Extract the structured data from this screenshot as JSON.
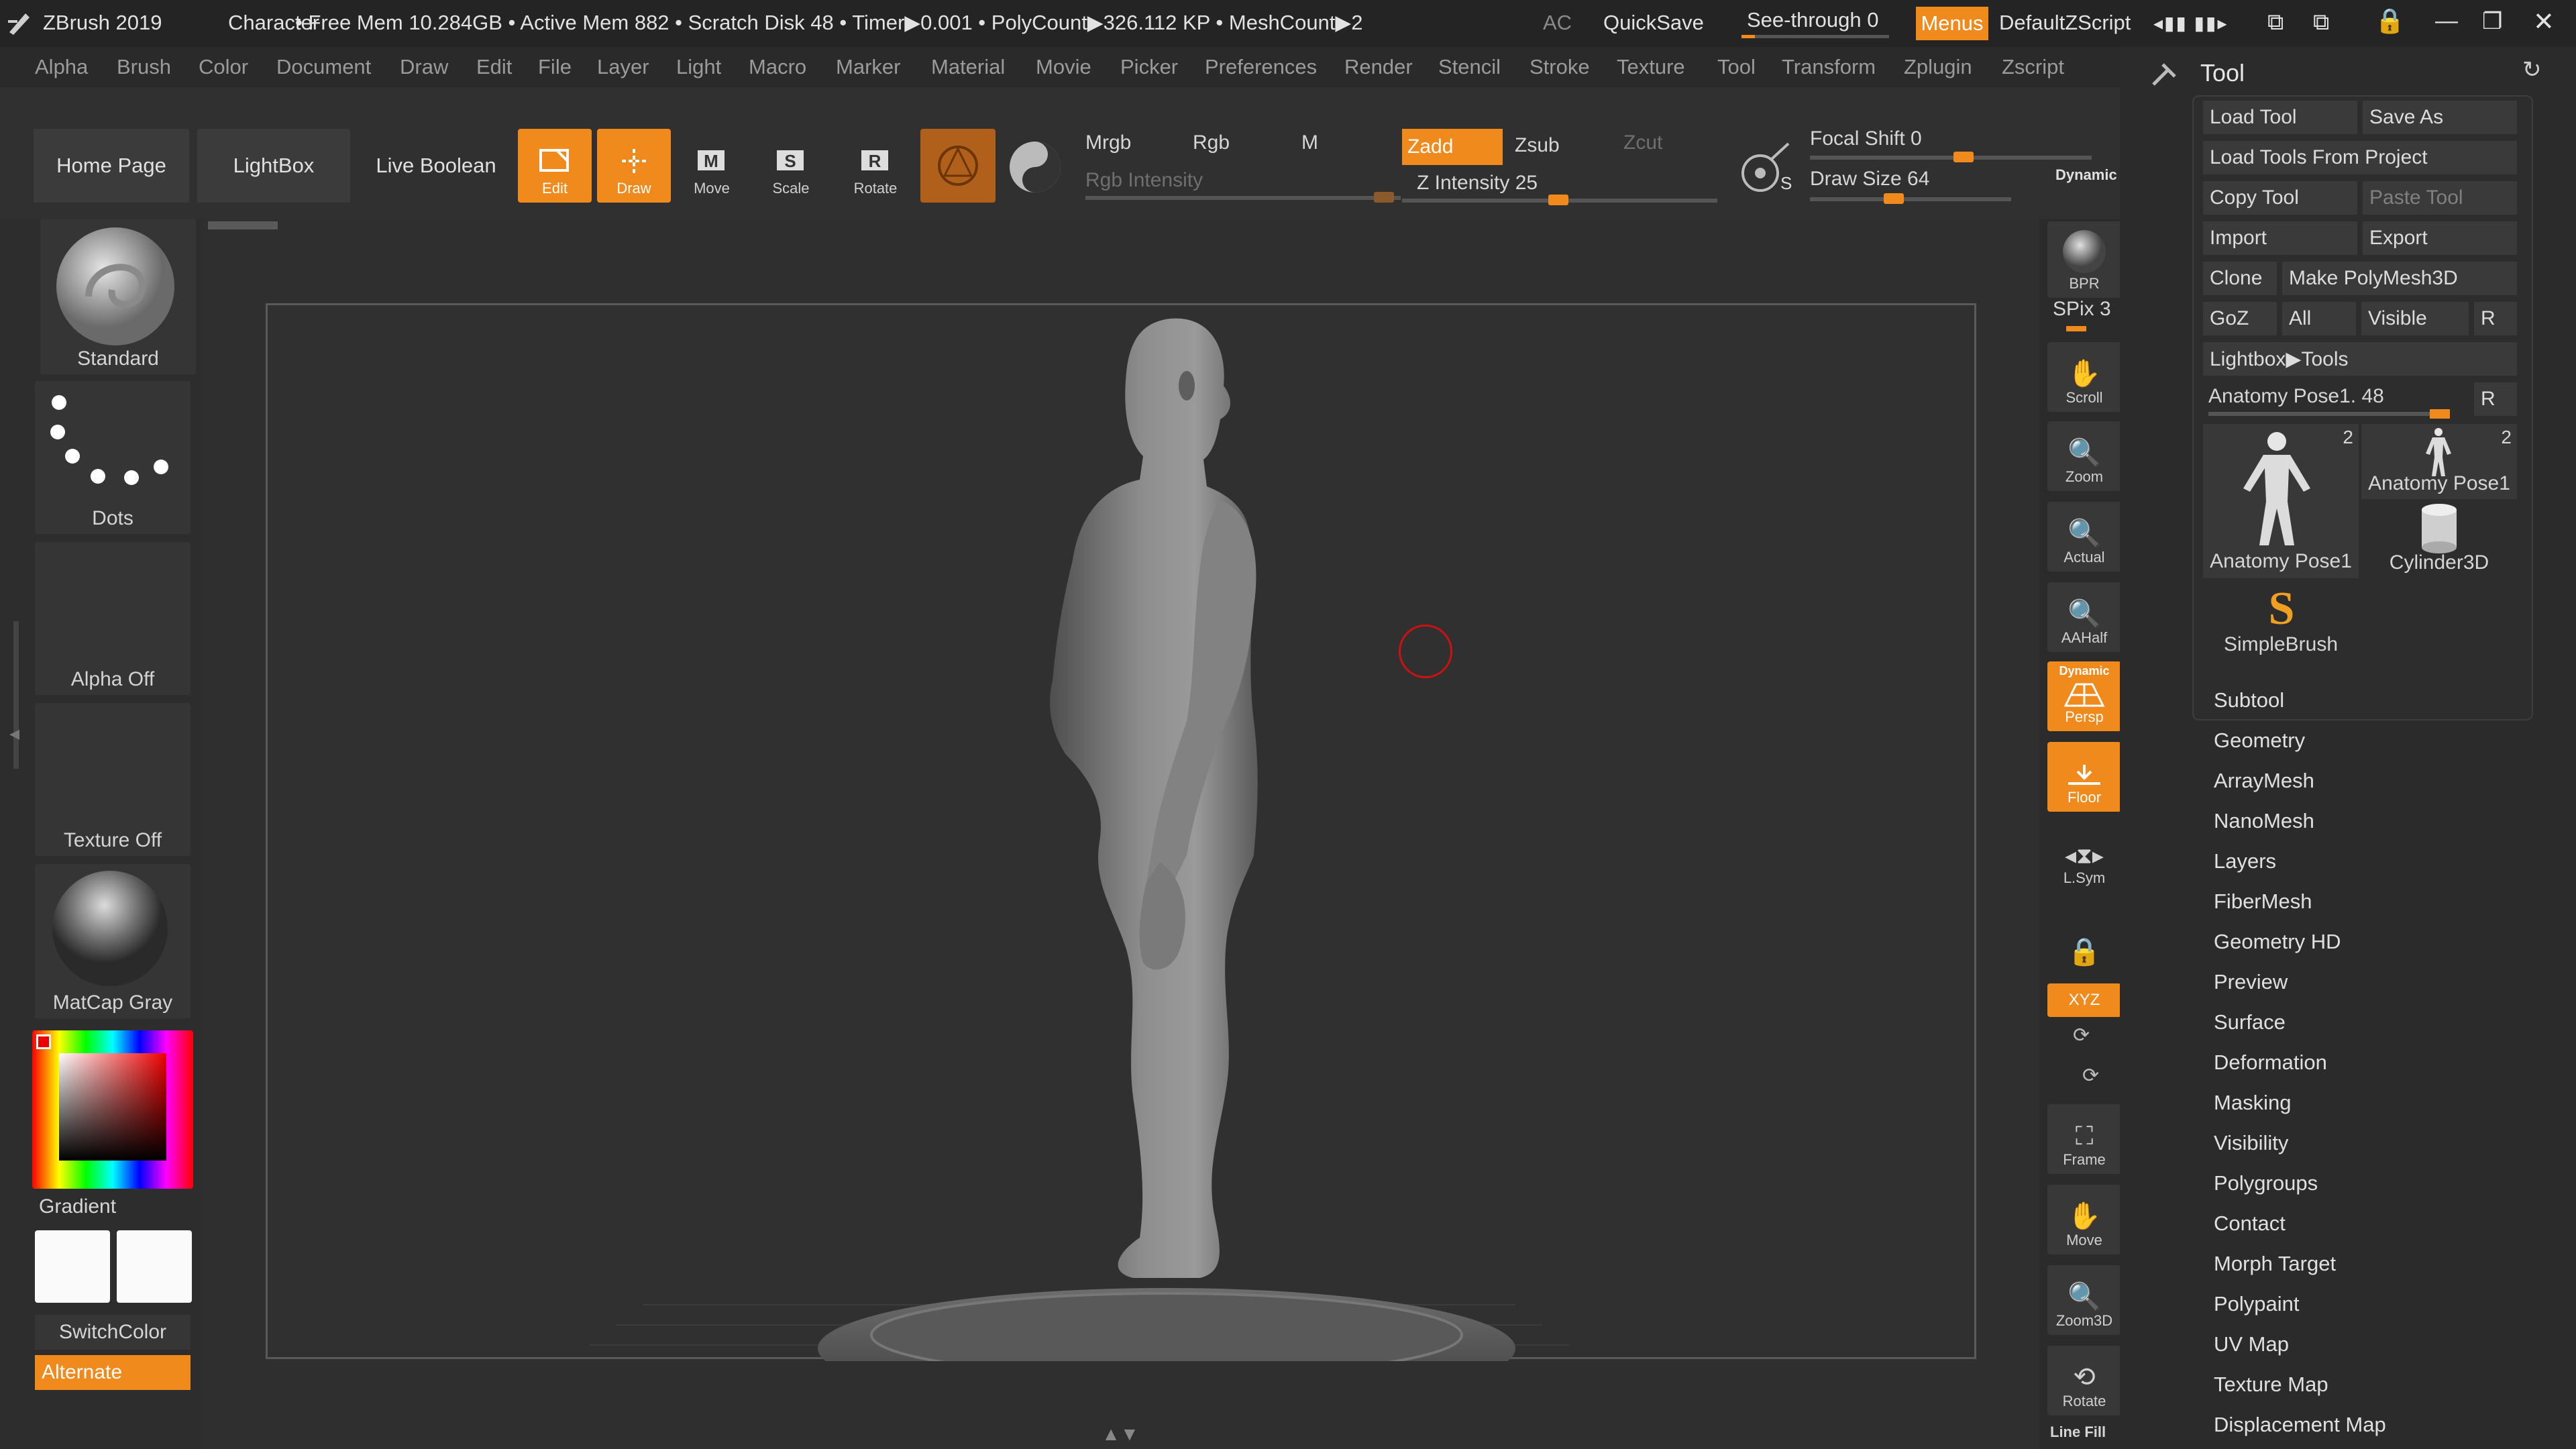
{
  "titlebar": {
    "app": "ZBrush 2019",
    "project": "Character",
    "status": "• Free Mem 10.284GB • Active Mem 882 • Scratch Disk 48 • Timer▶0.001 • PolyCount▶326.112 KP • MeshCount▶2",
    "ac": "AC",
    "quicksave": "QuickSave",
    "seethrough": "See-through  0",
    "seethrough_value": 0,
    "menus": "Menus",
    "script": "DefaultZScript"
  },
  "menubar": [
    "Alpha",
    "Brush",
    "Color",
    "Document",
    "Draw",
    "Edit",
    "File",
    "Layer",
    "Light",
    "Macro",
    "Marker",
    "Material",
    "Movie",
    "Picker",
    "Preferences",
    "Render",
    "Stencil",
    "Stroke",
    "Texture",
    "Tool",
    "Transform",
    "Zplugin",
    "Zscript"
  ],
  "toolbar": {
    "home": "Home Page",
    "lightbox": "LightBox",
    "liveboolean": "Live Boolean",
    "edit": "Edit",
    "draw": "Draw",
    "move": "Move",
    "scale": "Scale",
    "rotate": "Rotate",
    "mrgb": "Mrgb",
    "rgb": "Rgb",
    "m": "M",
    "rgb_intensity": "Rgb Intensity",
    "zadd": "Zadd",
    "zsub": "Zsub",
    "zcut": "Zcut",
    "z_intensity": "Z Intensity 25",
    "z_intensity_value": 25,
    "focal_shift": "Focal Shift 0",
    "focal_shift_value": 0,
    "draw_size": "Draw Size 64",
    "draw_size_value": 64,
    "dynamic": "Dynamic"
  },
  "left_shelf": {
    "brush": "Standard",
    "stroke": "Dots",
    "alpha": "Alpha Off",
    "texture": "Texture Off",
    "material": "MatCap Gray",
    "gradient": "Gradient",
    "switchcolor": "SwitchColor",
    "alternate": "Alternate"
  },
  "right_shelf": {
    "bpr": "BPR",
    "spix": "SPix 3",
    "scroll": "Scroll",
    "zoom": "Zoom",
    "actual": "Actual",
    "aahalf": "AAHalf",
    "persp": "Persp",
    "persp_top": "Dynamic",
    "floor": "Floor",
    "lsym": "L.Sym",
    "xyz": "XYZ",
    "frame": "Frame",
    "move": "Move",
    "zoom3d": "Zoom3D",
    "rotate": "Rotate",
    "linefill": "Line Fill"
  },
  "tool_panel": {
    "title": "Tool",
    "load_tool": "Load Tool",
    "save_as": "Save As",
    "load_from_project": "Load Tools From Project",
    "copy_tool": "Copy Tool",
    "paste_tool": "Paste Tool",
    "import": "Import",
    "export": "Export",
    "clone": "Clone",
    "make_polymesh": "Make PolyMesh3D",
    "goz": "GoZ",
    "all": "All",
    "visible": "Visible",
    "r": "R",
    "lightbox_tools": "Lightbox▶Tools",
    "current_tool": "Anatomy Pose1. 48",
    "current_tool_value": 48,
    "thumbs": [
      {
        "label": "Anatomy Pose1",
        "count": "2"
      },
      {
        "label": "Anatomy Pose1",
        "count": "2"
      },
      {
        "label": "Cylinder3D",
        "count": ""
      },
      {
        "label": "SimpleBrush",
        "count": ""
      }
    ],
    "sections": [
      "Subtool",
      "Geometry",
      "ArrayMesh",
      "NanoMesh",
      "Layers",
      "FiberMesh",
      "Geometry HD",
      "Preview",
      "Surface",
      "Deformation",
      "Masking",
      "Visibility",
      "Polygroups",
      "Contact",
      "Morph Target",
      "Polypaint",
      "UV Map",
      "Texture Map",
      "Displacement Map"
    ]
  },
  "colors": {
    "accent": "#f08a1c",
    "background": "#2a2a2a",
    "panel": "#3a3a3a"
  }
}
